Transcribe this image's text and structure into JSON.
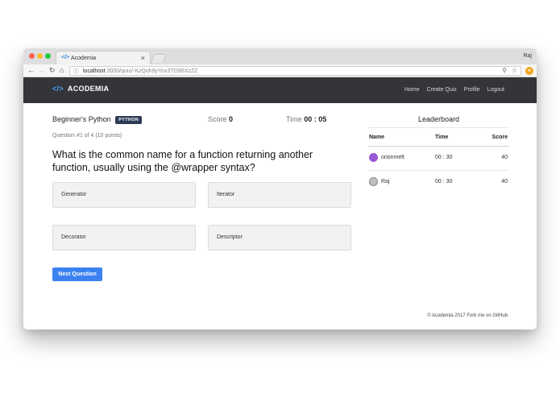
{
  "browser": {
    "tab_title": "Acodemia",
    "tab_favicon": "</>",
    "tab_close": "×",
    "profile_name": "Raj",
    "url_host": "localhost",
    "url_path": ":3000/quiz/-KzQoh9yYox3TO96XzZZ",
    "icons": [
      "back-arrow-icon",
      "forward-arrow-icon",
      "reload-icon",
      "home-icon",
      "info-icon",
      "zoom-icon",
      "star-icon",
      "extension-icon"
    ]
  },
  "navbar": {
    "brand_icon": "</>",
    "brand": "ACODEMIA",
    "links": [
      "Home",
      "Create Quiz",
      "Profile",
      "Logout"
    ]
  },
  "quiz": {
    "title": "Beginner's Python",
    "badge": "PYTHON",
    "score_label": "Score",
    "score_value": "0",
    "time_label": "Time",
    "time_value": "00 : 05",
    "question_info": "Question #1 of 4 (10 points)",
    "question": "What is the common name for a function returning another function, usually using the @wrapper syntax?",
    "answers": [
      "Generator",
      "Iterator",
      "Decorator",
      "Descriptor"
    ],
    "next_label": "Next Question"
  },
  "leaderboard": {
    "title": "Leaderboard",
    "headers": [
      "Name",
      "Time",
      "Score"
    ],
    "rows": [
      {
        "name": "orionmelt",
        "time": "00 : 30",
        "score": "40"
      },
      {
        "name": "Raj",
        "time": "00 : 30",
        "score": "40"
      }
    ]
  },
  "footer": {
    "copyright": "© Acodemia 2017",
    "fork": "Fork me on GitHub"
  },
  "colors": {
    "navbar_bg": "#333539",
    "brand_accent": "#4aa3ff",
    "badge_bg": "#2b3b55",
    "primary_button": "#3b82f0"
  }
}
